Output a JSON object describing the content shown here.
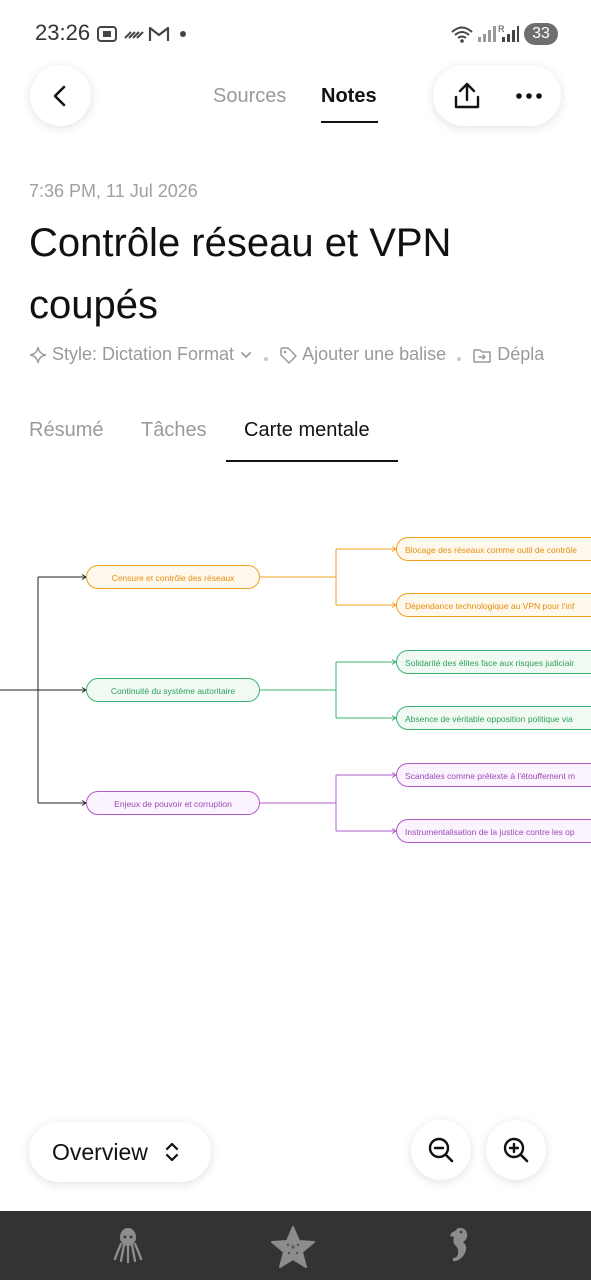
{
  "status_bar": {
    "time": "23:26",
    "battery": "33",
    "icons": [
      "screenshot-icon",
      "tiktok-icon",
      "gmail-icon",
      "notification-dot-icon",
      "wifi-icon",
      "signal-icon",
      "signal-roaming-icon"
    ]
  },
  "header": {
    "tabs": [
      {
        "label": "Sources",
        "active": false
      },
      {
        "label": "Notes",
        "active": true
      }
    ],
    "back_icon": "chevron-left-icon",
    "share_icon": "share-upload-icon",
    "more_icon": "more-horizontal-icon"
  },
  "note": {
    "timestamp": "7:36 PM, 11 Jul 2026",
    "title": "Contrôle réseau et VPN coupés",
    "meta": {
      "style_label": "Style: Dictation Format",
      "tag_label": "Ajouter une balise",
      "move_label": "Dépla"
    }
  },
  "content_tabs": [
    {
      "label": "Résumé",
      "active": false
    },
    {
      "label": "Tâches",
      "active": false
    },
    {
      "label": "Carte mentale",
      "active": true
    }
  ],
  "mindmap": {
    "branches": [
      {
        "label": "Censure et contrôle des réseaux",
        "color": "#f0a020",
        "fill": "#fff8ec",
        "text_color": "#e58e10",
        "leaves": [
          "Blocage des réseaux comme outil de contrôle",
          "Dépendance technologique au VPN pour l'inf"
        ]
      },
      {
        "label": "Continuité du système autoritaire",
        "color": "#3cb371",
        "fill": "#f0faf3",
        "text_color": "#2e9e5b",
        "leaves": [
          "Solidarité des élites face aux risques judiciair",
          "Absence de véritable opposition politique via"
        ]
      },
      {
        "label": "Enjeux de pouvoir et corruption",
        "color": "#b05cc8",
        "fill": "#fbf3fd",
        "text_color": "#9c4ab8",
        "leaves": [
          "Scandales comme prétexte à l'étouffement m",
          "Instrumentalisation de la justice contre les op"
        ]
      }
    ]
  },
  "controls": {
    "overview_label": "Overview",
    "overview_icon": "chevron-up-down-icon",
    "zoom_out_icon": "zoom-out-icon",
    "zoom_in_icon": "zoom-in-icon"
  },
  "nav_bar": {
    "icons": [
      "octopus-icon",
      "starfish-icon",
      "seahorse-icon"
    ]
  }
}
